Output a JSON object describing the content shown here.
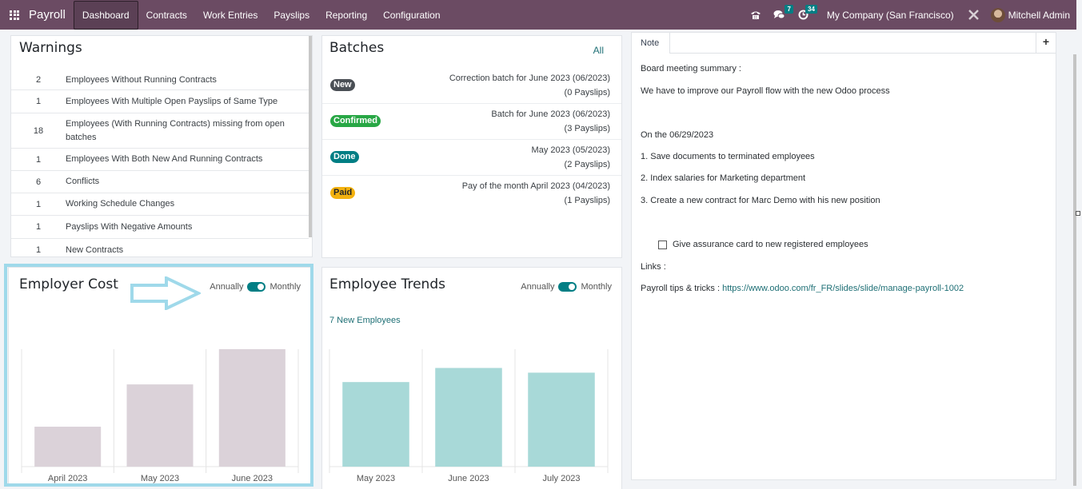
{
  "navbar": {
    "app_name": "Payroll",
    "menu": [
      "Dashboard",
      "Contracts",
      "Work Entries",
      "Payslips",
      "Reporting",
      "Configuration"
    ],
    "active": "Dashboard",
    "messages_count": "7",
    "activities_count": "34",
    "company": "My Company (San Francisco)",
    "user": "Mitchell Admin",
    "icons": [
      "apps-grid-icon",
      "phone-icon",
      "chat-icon",
      "clock-icon",
      "tools-icon",
      "avatar"
    ]
  },
  "warnings": {
    "title": "Warnings",
    "rows": [
      {
        "count": "2",
        "label": "Employees Without Running Contracts"
      },
      {
        "count": "1",
        "label": "Employees With Multiple Open Payslips of Same Type"
      },
      {
        "count": "18",
        "label": "Employees (With Running Contracts) missing from open batches"
      },
      {
        "count": "1",
        "label": "Employees With Both New And Running Contracts"
      },
      {
        "count": "6",
        "label": "Conflicts"
      },
      {
        "count": "1",
        "label": "Working Schedule Changes"
      },
      {
        "count": "1",
        "label": "Payslips With Negative Amounts"
      },
      {
        "count": "1",
        "label": "New Contracts"
      }
    ]
  },
  "batches": {
    "title": "Batches",
    "all_link": "All",
    "rows": [
      {
        "status": "New",
        "status_color": "#4a4f55",
        "status_text_color": "#ffffff",
        "name": "Correction batch for June 2023 (06/2023)",
        "payslips": "(0 Payslips)"
      },
      {
        "status": "Confirmed",
        "status_color": "#28a745",
        "status_text_color": "#ffffff",
        "name": "Batch for June 2023 (06/2023)",
        "payslips": "(3 Payslips)"
      },
      {
        "status": "Done",
        "status_color": "#017e84",
        "status_text_color": "#ffffff",
        "name": "May 2023 (05/2023)",
        "payslips": "(2 Payslips)"
      },
      {
        "status": "Paid",
        "status_color": "#f3b10f",
        "status_text_color": "#1f2328",
        "name": "Pay of the month April 2023 (04/2023)",
        "payslips": "(1 Payslips)"
      }
    ]
  },
  "note": {
    "tab": "Note",
    "add_label": "+",
    "lines": [
      "Board meeting summary :",
      "We have to improve our Payroll flow with the new Odoo process",
      "On the 06/29/2023",
      "1. Save documents to terminated employees",
      "2. Index salaries for Marketing department",
      "3. Create a new contract for Marc Demo with his new position"
    ],
    "checklist_item": "Give assurance card to new registered employees",
    "checklist_checked": false,
    "links_label": "Links :",
    "tips_label": "Payroll tips & tricks : ",
    "tips_url": "https://www.odoo.com/fr_FR/slides/slide/manage-payroll-1002"
  },
  "employer_cost": {
    "title": "Employer Cost",
    "toggle_left": "Annually",
    "toggle_right": "Monthly",
    "toggle_state": "Monthly"
  },
  "employee_trends": {
    "title": "Employee Trends",
    "toggle_left": "Annually",
    "toggle_right": "Monthly",
    "toggle_state": "Monthly",
    "new_employees_link": "7 New Employees"
  },
  "chart_data": [
    {
      "type": "bar",
      "title": "Employer Cost",
      "categories": [
        "April 2023",
        "May 2023",
        "June 2023"
      ],
      "values": [
        34,
        70,
        100
      ],
      "ylim": [
        0,
        100
      ],
      "value_note": "relative heights, axis values not shown",
      "color": "#dbd2d9",
      "grid": true,
      "xlabel": "",
      "ylabel": ""
    },
    {
      "type": "bar",
      "title": "Employee Trends",
      "categories": [
        "May 2023",
        "June 2023",
        "July 2023"
      ],
      "values": [
        72,
        84,
        80
      ],
      "ylim": [
        0,
        100
      ],
      "value_note": "relative heights, axis values not shown",
      "color": "#a8d9d8",
      "grid": true,
      "xlabel": "",
      "ylabel": ""
    }
  ]
}
